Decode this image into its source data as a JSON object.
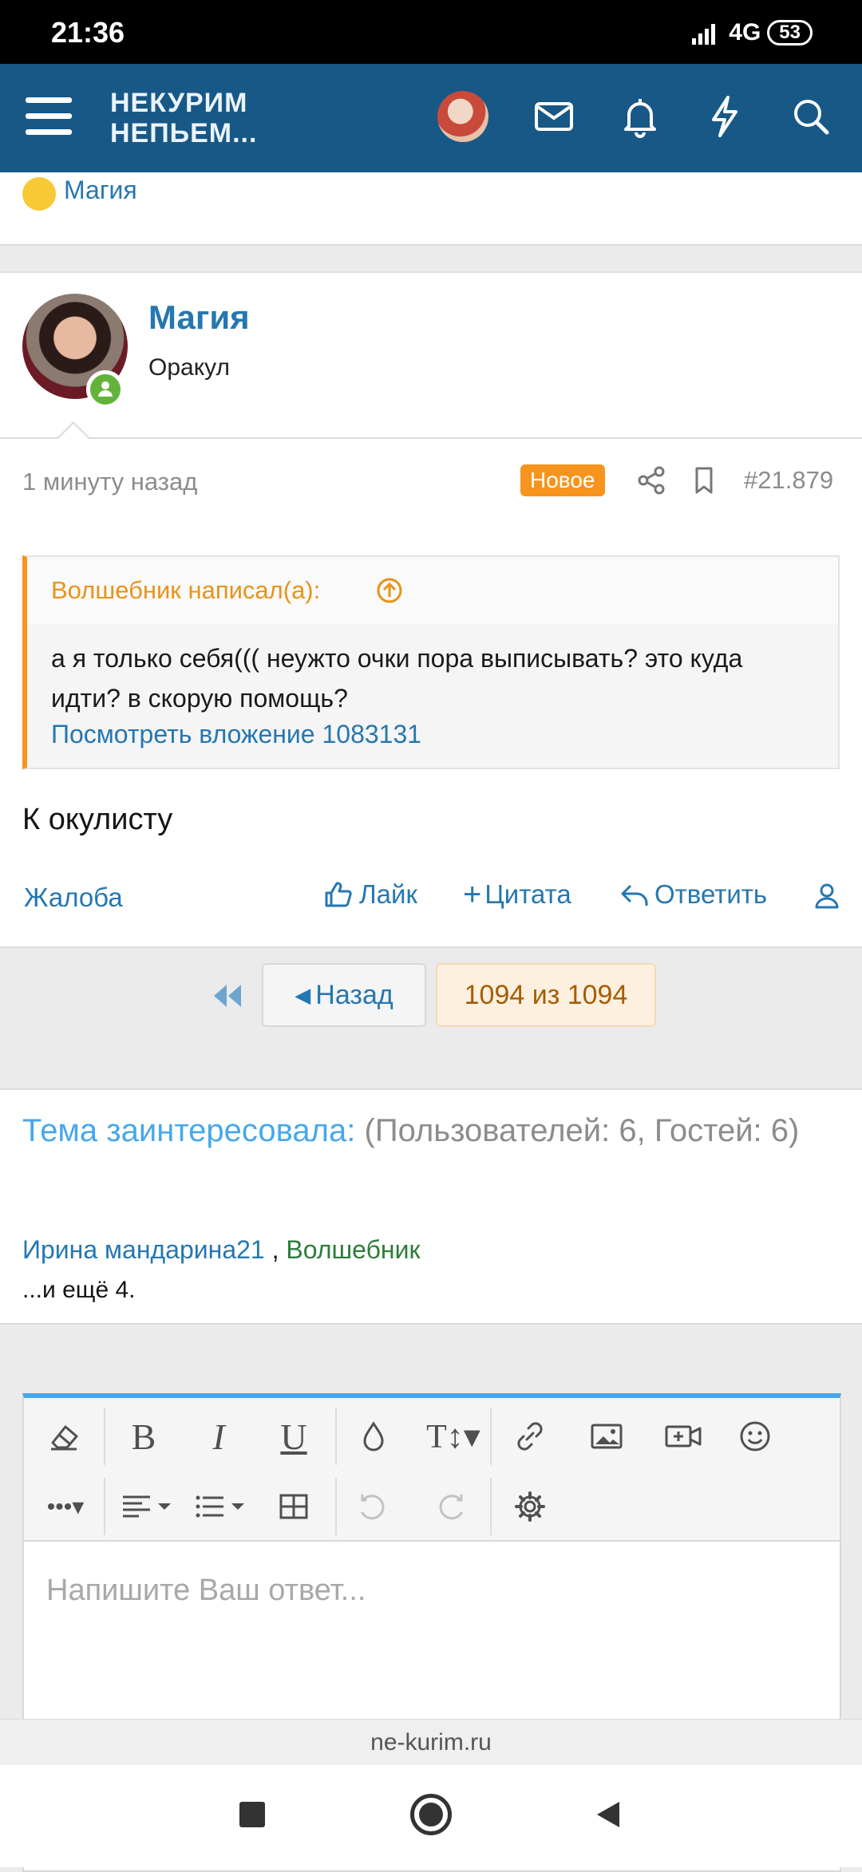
{
  "status_bar": {
    "time": "21:36",
    "network": "4G",
    "battery": "53"
  },
  "header": {
    "logo_line1": "НЕКУРИМ",
    "logo_line2": "НЕПЬЕМ..."
  },
  "prev_reaction": {
    "user": "Магия"
  },
  "post": {
    "author": "Магия",
    "role": "Оракул",
    "time": "1 минуту назад",
    "badge": "Новое",
    "number": "#21.879",
    "quote": {
      "attribution": "Волшебник написал(а):",
      "text": "а я только себя((( неужто очки пора выписывать? это куда идти? в скорую помощь?",
      "link": "Посмотреть вложение 1083131"
    },
    "body": "К окулисту",
    "actions": {
      "report": "Жалоба",
      "like": "Лайк",
      "quote": "Цитата",
      "reply": "Ответить"
    }
  },
  "pagination": {
    "back": "Назад",
    "page_info": "1094 из 1094"
  },
  "interested": {
    "title": "Тема заинтересовала:",
    "counts": "(Пользователей: 6, Гостей: 6)",
    "user1": "Ирина мандарина21",
    "separator": " ,",
    "user2": "Волшебник",
    "more": "...и ещё 4."
  },
  "editor": {
    "placeholder": "Напишите Ваш ответ..."
  },
  "browser": {
    "url": "ne-kurim.ru"
  },
  "colors": {
    "header": "#185886",
    "accent": "#2577b1",
    "badge": "#f7941d",
    "quote_border": "#f7941d",
    "green": "#2d7d3a"
  }
}
